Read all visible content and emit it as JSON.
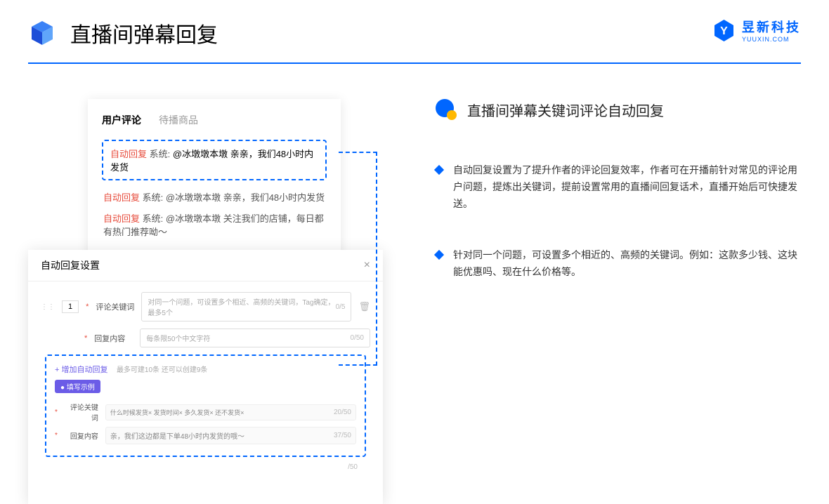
{
  "header": {
    "title": "直播间弹幕回复"
  },
  "brand": {
    "name": "昱新科技",
    "url": "YUUXIN.COM"
  },
  "section": {
    "title": "直播间弹幕关键词评论自动回复",
    "bullets": [
      "自动回复设置为了提升作者的评论回复效率，作者可在开播前针对常见的评论用户问题，提炼出关键词，提前设置常用的直播间回复话术，直播开始后可快捷发送。",
      "针对同一个问题，可设置多个相近的、高频的关键词。例如：这款多少钱、这块能优惠吗、现在什么价格等。"
    ]
  },
  "comments": {
    "tab_active": "用户评论",
    "tab_inactive": "待播商品",
    "highlighted": {
      "tag": "自动回复",
      "sys": "系统:",
      "text": "@冰墩墩本墩 亲亲，我们48小时内发货"
    },
    "rows": [
      {
        "tag": "自动回复",
        "sys": "系统:",
        "text": "@冰墩墩本墩 亲亲，我们48小时内发货"
      },
      {
        "tag": "自动回复",
        "sys": "系统:",
        "text": "@冰墩墩本墩 关注我们的店铺，每日都有热门推荐呦～"
      }
    ]
  },
  "settings": {
    "title": "自动回复设置",
    "num": "1",
    "label_keyword": "评论关键词",
    "placeholder_keyword": "对同一个问题，可设置多个相近、高频的关键词，Tag确定，最多5个",
    "counter_keyword": "0/5",
    "label_content": "回复内容",
    "placeholder_content": "每条限50个中文字符",
    "counter_content": "0/50",
    "add_text": "+ 增加自动回复",
    "add_sub": "最多可建10条 还可以创建9条",
    "example_badge": "● 填写示例",
    "example_kw_label": "评论关键词",
    "example_kw_tags": "什么时候发货×    发货时间×    多久发货×    还不发货×",
    "example_kw_counter": "20/50",
    "example_ct_label": "回复内容",
    "example_ct_text": "亲，我们这边都是下单48小时内发货的哦～",
    "example_ct_counter": "37/50",
    "trailing_counter": "/50"
  }
}
